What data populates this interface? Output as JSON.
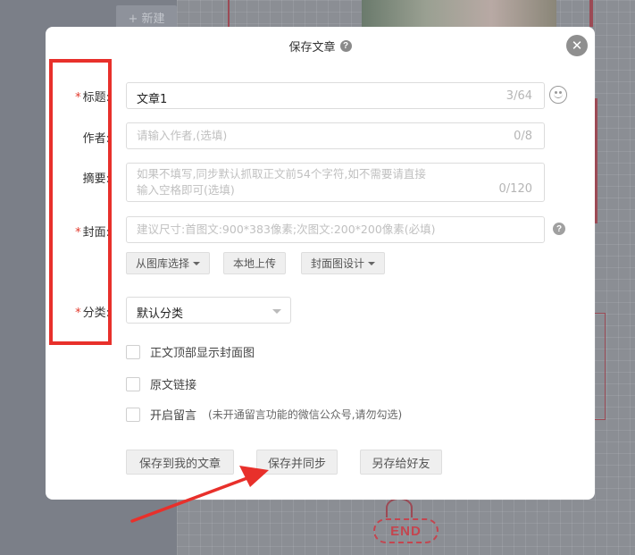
{
  "background": {
    "new_button": "+ 新建",
    "end_label": "END"
  },
  "dialog": {
    "title": "保存文章",
    "fields": {
      "title": {
        "label": "标题:",
        "value": "文章1",
        "counter": "3/64"
      },
      "author": {
        "label": "作者:",
        "placeholder": "请输入作者,(选填)",
        "counter": "0/8"
      },
      "summary": {
        "label": "摘要:",
        "placeholder_line1": "如果不填写,同步默认抓取正文前54个字符,如不需要请直接",
        "placeholder_line2": "输入空格即可(选填)",
        "counter": "0/120"
      },
      "cover": {
        "label": "封面:",
        "placeholder": "建议尺寸:首图文:900*383像素;次图文:200*200像素(必填)",
        "buttons": [
          "从图库选择",
          "本地上传",
          "封面图设计"
        ]
      },
      "category": {
        "label": "分类:",
        "value": "默认分类"
      }
    },
    "required_marker": "*",
    "checkboxes": [
      {
        "label": "正文顶部显示封面图",
        "note": ""
      },
      {
        "label": "原文链接",
        "note": ""
      },
      {
        "label": "开启留言",
        "note": "(未开通留言功能的微信公众号,请勿勾选)"
      }
    ],
    "footer_buttons": [
      "保存到我的文章",
      "保存并同步",
      "另存给好友"
    ]
  },
  "icons": {
    "help": "help-circle-icon",
    "close": "close-icon",
    "emoji": "smiley-icon",
    "caret": "caret-down-icon"
  },
  "colors": {
    "required": "#e2392c",
    "annotation": "#e8302b",
    "button_bg": "#efefef"
  }
}
